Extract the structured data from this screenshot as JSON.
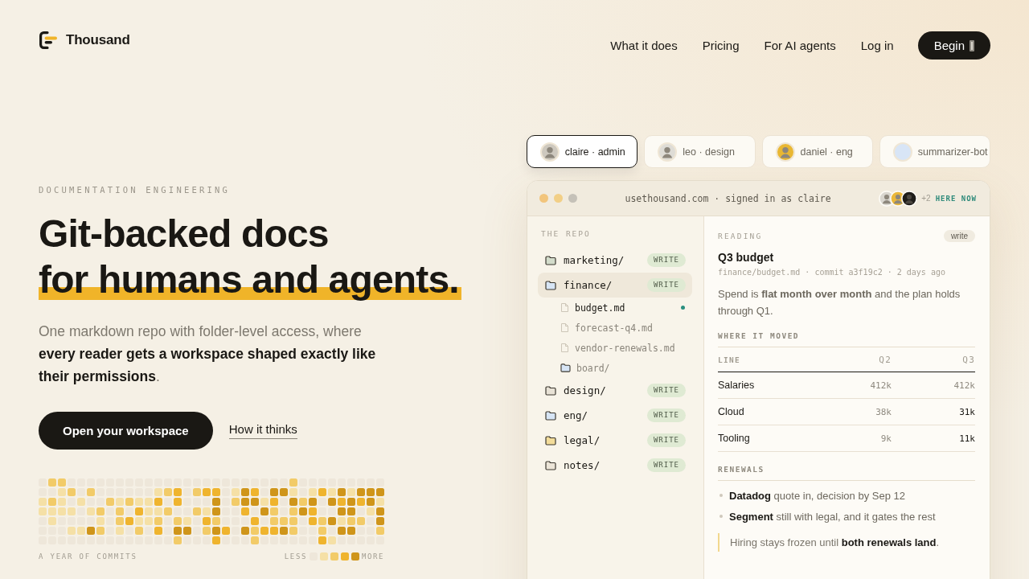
{
  "header": {
    "brand": "Thousand",
    "nav": [
      {
        "label": "What it does"
      },
      {
        "label": "Pricing"
      },
      {
        "label": "For AI agents"
      },
      {
        "label": "Log in"
      }
    ],
    "cta": "Begin"
  },
  "hero": {
    "eyebrow": "DOCUMENTATION ENGINEERING",
    "heading": [
      {
        "text": "Git-backed docs",
        "highlighted": false
      },
      {
        "text": "for humans and agents.",
        "highlighted": true
      }
    ],
    "lede": "One markdown repo with folder-level access, where **every reader gets a workspace shaped exactly like their permissions**.",
    "primary_button": "Open your workspace",
    "secondary_link": "How it thinks",
    "commits": {
      "rows": [
        [
          {
            "color": "#eee7da"
          },
          {
            "color": "#f2cb68"
          },
          {
            "color": "#f2cb68"
          },
          {
            "color": "#eee7da"
          },
          {
            "color": "#eee7da"
          },
          {
            "color": "#eee7da"
          },
          {
            "color": "#eee7da"
          },
          {
            "color": "#eee7da"
          },
          {
            "color": "#eee7da"
          },
          {
            "color": "#eee7da"
          },
          {
            "color": "#eee7da"
          },
          {
            "color": "#eee7da"
          },
          {
            "color": "#eee7da"
          },
          {
            "color": "#eee7da"
          },
          {
            "color": "#eee7da"
          },
          {
            "color": "#eee7da"
          },
          {
            "color": "#eee7da"
          },
          {
            "color": "#eee7da"
          },
          {
            "color": "#eee7da"
          },
          {
            "color": "#eee7da"
          },
          {
            "color": "#eee7da"
          },
          {
            "color": "#eee7da"
          },
          {
            "color": "#eee7da"
          },
          {
            "color": "#eee7da"
          },
          {
            "color": "#eee7da"
          },
          {
            "color": "#eee7da"
          },
          {
            "color": "#f2cb68"
          },
          {
            "color": "#eee7da"
          },
          {
            "color": "#eee7da"
          },
          {
            "color": "#eee7da"
          },
          {
            "color": "#eee7da"
          },
          {
            "color": "#eee7da"
          },
          {
            "color": "#eee7da"
          },
          {
            "color": "#eee7da"
          },
          {
            "color": "#eee7da"
          },
          {
            "color": "#eee7da"
          }
        ],
        [
          {
            "color": "#eee7da"
          },
          {
            "color": "#eee7da"
          },
          {
            "color": "#f5e0a6"
          },
          {
            "color": "#f2cb68"
          },
          {
            "color": "#eee7da"
          },
          {
            "color": "#f2cb68"
          },
          {
            "color": "#eee7da"
          },
          {
            "color": "#eee7da"
          },
          {
            "color": "#eee7da"
          },
          {
            "color": "#eee7da"
          },
          {
            "color": "#eee7da"
          },
          {
            "color": "#eee7da"
          },
          {
            "color": "#f5e0a6"
          },
          {
            "color": "#f2cb68"
          },
          {
            "color": "#efb42e"
          },
          {
            "color": "#eee7da"
          },
          {
            "color": "#f2cb68"
          },
          {
            "color": "#efb42e"
          },
          {
            "color": "#efb42e"
          },
          {
            "color": "#eee7da"
          },
          {
            "color": "#f5e0a6"
          },
          {
            "color": "#cf951a"
          },
          {
            "color": "#efb42e"
          },
          {
            "color": "#eee7da"
          },
          {
            "color": "#cf951a"
          },
          {
            "color": "#cf951a"
          },
          {
            "color": "#f5e0a6"
          },
          {
            "color": "#eee7da"
          },
          {
            "color": "#f5e0a6"
          },
          {
            "color": "#efb42e"
          },
          {
            "color": "#f5e0a6"
          },
          {
            "color": "#cf951a"
          },
          {
            "color": "#f5e0a6"
          },
          {
            "color": "#cf951a"
          },
          {
            "color": "#cf951a"
          },
          {
            "color": "#cf951a"
          }
        ],
        [
          {
            "color": "#f5e0a6"
          },
          {
            "color": "#f2cb68"
          },
          {
            "color": "#f5e0a6"
          },
          {
            "color": "#eee7da"
          },
          {
            "color": "#f5e0a6"
          },
          {
            "color": "#eee7da"
          },
          {
            "color": "#eee7da"
          },
          {
            "color": "#f2cb68"
          },
          {
            "color": "#f5e0a6"
          },
          {
            "color": "#f2cb68"
          },
          {
            "color": "#f5e0a6"
          },
          {
            "color": "#f5e0a6"
          },
          {
            "color": "#efb42e"
          },
          {
            "color": "#eee7da"
          },
          {
            "color": "#efb42e"
          },
          {
            "color": "#eee7da"
          },
          {
            "color": "#eee7da"
          },
          {
            "color": "#eee7da"
          },
          {
            "color": "#cf951a"
          },
          {
            "color": "#eee7da"
          },
          {
            "color": "#f2cb68"
          },
          {
            "color": "#cf951a"
          },
          {
            "color": "#cf951a"
          },
          {
            "color": "#f5e0a6"
          },
          {
            "color": "#efb42e"
          },
          {
            "color": "#eee7da"
          },
          {
            "color": "#cf951a"
          },
          {
            "color": "#f2cb68"
          },
          {
            "color": "#cf951a"
          },
          {
            "color": "#eee7da"
          },
          {
            "color": "#cf951a"
          },
          {
            "color": "#efb42e"
          },
          {
            "color": "#cf951a"
          },
          {
            "color": "#efb42e"
          },
          {
            "color": "#cf951a"
          },
          {
            "color": "#f5e0a6"
          }
        ],
        [
          {
            "color": "#f5e0a6"
          },
          {
            "color": "#f5e0a6"
          },
          {
            "color": "#f5e0a6"
          },
          {
            "color": "#f5e0a6"
          },
          {
            "color": "#eee7da"
          },
          {
            "color": "#f5e0a6"
          },
          {
            "color": "#f2cb68"
          },
          {
            "color": "#eee7da"
          },
          {
            "color": "#f2cb68"
          },
          {
            "color": "#eee7da"
          },
          {
            "color": "#efb42e"
          },
          {
            "color": "#f5e0a6"
          },
          {
            "color": "#f5e0a6"
          },
          {
            "color": "#f2cb68"
          },
          {
            "color": "#eee7da"
          },
          {
            "color": "#eee7da"
          },
          {
            "color": "#f2cb68"
          },
          {
            "color": "#f5e0a6"
          },
          {
            "color": "#cf951a"
          },
          {
            "color": "#eee7da"
          },
          {
            "color": "#eee7da"
          },
          {
            "color": "#efb42e"
          },
          {
            "color": "#eee7da"
          },
          {
            "color": "#cf951a"
          },
          {
            "color": "#f2cb68"
          },
          {
            "color": "#eee7da"
          },
          {
            "color": "#f2cb68"
          },
          {
            "color": "#cf951a"
          },
          {
            "color": "#efb42e"
          },
          {
            "color": "#eee7da"
          },
          {
            "color": "#eee7da"
          },
          {
            "color": "#cf951a"
          },
          {
            "color": "#cf951a"
          },
          {
            "color": "#eee7da"
          },
          {
            "color": "#f5e0a6"
          },
          {
            "color": "#cf951a"
          }
        ],
        [
          {
            "color": "#eee7da"
          },
          {
            "color": "#f5e0a6"
          },
          {
            "color": "#eee7da"
          },
          {
            "color": "#eee7da"
          },
          {
            "color": "#eee7da"
          },
          {
            "color": "#eee7da"
          },
          {
            "color": "#f5e0a6"
          },
          {
            "color": "#eee7da"
          },
          {
            "color": "#f2cb68"
          },
          {
            "color": "#efb42e"
          },
          {
            "color": "#f5e0a6"
          },
          {
            "color": "#f5e0a6"
          },
          {
            "color": "#f2cb68"
          },
          {
            "color": "#eee7da"
          },
          {
            "color": "#f2cb68"
          },
          {
            "color": "#f5e0a6"
          },
          {
            "color": "#eee7da"
          },
          {
            "color": "#efb42e"
          },
          {
            "color": "#f2cb68"
          },
          {
            "color": "#eee7da"
          },
          {
            "color": "#eee7da"
          },
          {
            "color": "#eee7da"
          },
          {
            "color": "#efb42e"
          },
          {
            "color": "#eee7da"
          },
          {
            "color": "#f2cb68"
          },
          {
            "color": "#f2cb68"
          },
          {
            "color": "#f2cb68"
          },
          {
            "color": "#eee7da"
          },
          {
            "color": "#efb42e"
          },
          {
            "color": "#f2cb68"
          },
          {
            "color": "#cf951a"
          },
          {
            "color": "#f5e0a6"
          },
          {
            "color": "#f2cb68"
          },
          {
            "color": "#f2cb68"
          },
          {
            "color": "#eee7da"
          },
          {
            "color": "#cf951a"
          }
        ],
        [
          {
            "color": "#eee7da"
          },
          {
            "color": "#eee7da"
          },
          {
            "color": "#eee7da"
          },
          {
            "color": "#f5e0a6"
          },
          {
            "color": "#f5e0a6"
          },
          {
            "color": "#cf951a"
          },
          {
            "color": "#f2cb68"
          },
          {
            "color": "#eee7da"
          },
          {
            "color": "#f5e0a6"
          },
          {
            "color": "#eee7da"
          },
          {
            "color": "#f2cb68"
          },
          {
            "color": "#eee7da"
          },
          {
            "color": "#efb42e"
          },
          {
            "color": "#eee7da"
          },
          {
            "color": "#cf951a"
          },
          {
            "color": "#cf951a"
          },
          {
            "color": "#eee7da"
          },
          {
            "color": "#f2cb68"
          },
          {
            "color": "#cf951a"
          },
          {
            "color": "#efb42e"
          },
          {
            "color": "#eee7da"
          },
          {
            "color": "#cf951a"
          },
          {
            "color": "#f2cb68"
          },
          {
            "color": "#efb42e"
          },
          {
            "color": "#efb42e"
          },
          {
            "color": "#cf951a"
          },
          {
            "color": "#f2cb68"
          },
          {
            "color": "#eee7da"
          },
          {
            "color": "#eee7da"
          },
          {
            "color": "#f2cb68"
          },
          {
            "color": "#eee7da"
          },
          {
            "color": "#cf951a"
          },
          {
            "color": "#cf951a"
          },
          {
            "color": "#eee7da"
          },
          {
            "color": "#eee7da"
          },
          {
            "color": "#f2cb68"
          }
        ],
        [
          {
            "color": "#eee7da"
          },
          {
            "color": "#eee7da"
          },
          {
            "color": "#eee7da"
          },
          {
            "color": "#eee7da"
          },
          {
            "color": "#eee7da"
          },
          {
            "color": "#eee7da"
          },
          {
            "color": "#eee7da"
          },
          {
            "color": "#eee7da"
          },
          {
            "color": "#eee7da"
          },
          {
            "color": "#eee7da"
          },
          {
            "color": "#eee7da"
          },
          {
            "color": "#eee7da"
          },
          {
            "color": "#eee7da"
          },
          {
            "color": "#eee7da"
          },
          {
            "color": "#f2cb68"
          },
          {
            "color": "#eee7da"
          },
          {
            "color": "#eee7da"
          },
          {
            "color": "#eee7da"
          },
          {
            "color": "#efb42e"
          },
          {
            "color": "#eee7da"
          },
          {
            "color": "#eee7da"
          },
          {
            "color": "#eee7da"
          },
          {
            "color": "#f2cb68"
          },
          {
            "color": "#eee7da"
          },
          {
            "color": "#eee7da"
          },
          {
            "color": "#eee7da"
          },
          {
            "color": "#eee7da"
          },
          {
            "color": "#eee7da"
          },
          {
            "color": "#eee7da"
          },
          {
            "color": "#efb42e"
          },
          {
            "color": "#f5e0a6"
          },
          {
            "color": "#eee7da"
          },
          {
            "color": "#eee7da"
          },
          {
            "color": "#eee7da"
          },
          {
            "color": "#eee7da"
          },
          {
            "color": "#eee7da"
          }
        ]
      ],
      "caption": "A YEAR OF COMMITS",
      "legend": {
        "less": "LESS",
        "more": "MORE",
        "swatches": [
          {
            "color": "#eee7da"
          },
          {
            "color": "#f5e0a6"
          },
          {
            "color": "#f2cb68"
          },
          {
            "color": "#efb42e"
          },
          {
            "color": "#cf951a"
          }
        ]
      }
    }
  },
  "workspace": {
    "users": [
      {
        "name": "claire · admin",
        "kind": "person",
        "color": "#cdc8be",
        "selected": true
      },
      {
        "name": "leo · design",
        "kind": "person",
        "color": "#dedcd6",
        "selected": false
      },
      {
        "name": "daniel · eng",
        "kind": "person",
        "color": "#e9b732",
        "selected": false
      },
      {
        "name": "summarizer-bot",
        "kind": "bot",
        "color": "#d8e5f6",
        "selected": false
      }
    ],
    "window": {
      "address": "usethousand.com · signed in as claire",
      "presence": {
        "avatars": [
          {
            "color": "#d9d6cf"
          },
          {
            "color": "#ebb83a"
          },
          {
            "color": "#1f1d1a"
          }
        ],
        "more": "+2",
        "label": "HERE NOW"
      },
      "sidebar": {
        "title": "THE REPO",
        "items": [
          {
            "name": "marketing/",
            "color": "#d3dccb",
            "badge": "WRITE",
            "selected": false
          },
          {
            "name": "finance/",
            "color": "#d7e5f5",
            "badge": "WRITE",
            "selected": true,
            "children": [
              {
                "kind": "file",
                "name": "budget.md",
                "selected": true
              },
              {
                "kind": "file",
                "name": "forecast-q4.md",
                "selected": false
              },
              {
                "kind": "file",
                "name": "vendor-renewals.md",
                "selected": false
              },
              {
                "kind": "folder",
                "name": "board/",
                "color": "#d7e5f5",
                "selected": false
              }
            ]
          },
          {
            "name": "design/",
            "color": "#e8e2d6",
            "badge": "WRITE",
            "selected": false
          },
          {
            "name": "eng/",
            "color": "#d7e5f5",
            "badge": "WRITE",
            "selected": false
          },
          {
            "name": "legal/",
            "color": "#f3dc9a",
            "badge": "WRITE",
            "selected": false
          },
          {
            "name": "notes/",
            "color": "#ece5d8",
            "badge": "WRITE",
            "selected": false
          }
        ]
      },
      "reader": {
        "label": "READING",
        "access": "write",
        "title": "Q3 budget",
        "meta": "finance/budget.md · commit a3f19c2 · 2 days ago",
        "summary": "Spend is **flat month over month** and the plan holds through Q1.",
        "table_title": "WHERE IT MOVED",
        "table": {
          "columns": [
            "LINE",
            "Q2",
            "Q3"
          ],
          "rows": [
            {
              "cells": [
                "Salaries",
                "412k",
                "412k"
              ],
              "changed": false
            },
            {
              "cells": [
                "Cloud",
                "38k",
                "31k"
              ],
              "changed": true
            },
            {
              "cells": [
                "Tooling",
                "9k",
                "11k"
              ],
              "changed": true
            }
          ]
        },
        "renewals_title": "RENEWALS",
        "renewals": [
          "**Datadog** quote in, decision by Sep 12",
          "**Segment** still with legal, and it gates the rest"
        ],
        "note": "Hiring stays frozen until **both renewals land**."
      }
    }
  }
}
